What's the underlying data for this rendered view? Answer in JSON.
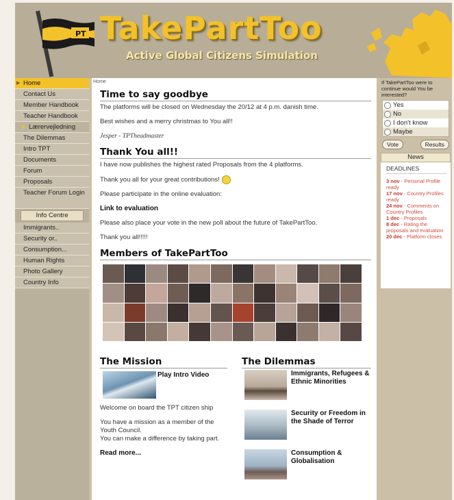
{
  "header": {
    "title": "TakePartToo",
    "subtitle": "Active Global Citizens Simulation",
    "flag_text": "PT"
  },
  "nav": {
    "items": [
      {
        "label": "Home"
      },
      {
        "label": "Contact Us"
      },
      {
        "label": "Member Handbook"
      },
      {
        "label": "Teacher Handbook"
      },
      {
        "label": "Lærervejledning"
      },
      {
        "label": "The Dilemmas"
      },
      {
        "label": "Intro TPT"
      },
      {
        "label": "Documents"
      },
      {
        "label": "Forum"
      },
      {
        "label": "Proposals"
      },
      {
        "label": "Teacher Forum Login"
      }
    ],
    "info_header": "Info Centre",
    "info_items": [
      {
        "label": "Immigrants.."
      },
      {
        "label": "Security or.."
      },
      {
        "label": "Consumption..."
      },
      {
        "label": "Human Rights"
      },
      {
        "label": "Photo Gallery"
      },
      {
        "label": "Country Info"
      }
    ]
  },
  "main": {
    "breadcrumb": "Home",
    "post1": {
      "title": "Time to say goodbye",
      "p1": "The platforms will be closed on Wednesday the 20/12 at 4 p.m. danish time.",
      "p2": "Best wishes and a merry christmas to You all!!",
      "signature": "Jesper - TPTheadmaster"
    },
    "post2": {
      "title": "Thank You all!!",
      "p1": "I have now publishes the highest rated Proposals from the 4 platforms.",
      "p2": "Thank you all for your great contributions!",
      "p3": "Please participate in the online evaluation:",
      "link": "Link to evaluation",
      "p4": "Please also place your vote in the new poll about the future of TakePartToo.",
      "p5": "Thank you all!!!!!"
    },
    "members_title": "Members of TakePartToo",
    "mission": {
      "title": "The Mission",
      "video_label": "Play Intro Video",
      "p1": "Welcome on board the TPT citizen ship",
      "p2": "You have a mission as a member of the Youth Council.",
      "p3": "You can make a difference by taking part.",
      "read_more": "Read more..."
    },
    "dilemmas": {
      "title": "The Dilemmas",
      "items": [
        {
          "label": "Immigrants, Refugees & Ethnic Minorities"
        },
        {
          "label": "Security or Freedom in the Shade of Terror"
        },
        {
          "label": "Consumption & Globalisation"
        }
      ]
    }
  },
  "poll": {
    "question": "If TakePartToo were to continue would You be interested?",
    "options": [
      "Yes",
      "No",
      "I don't know",
      "Maybe"
    ],
    "vote_label": "Vote",
    "results_label": "Results"
  },
  "news": {
    "header": "News",
    "deadlines_title": "DEADLINES",
    "items": [
      {
        "date": "3 nov",
        "text": " - Personal Profile ready"
      },
      {
        "date": "17 nov",
        "text": " - Country Profiles ready"
      },
      {
        "date": "24 nov",
        "text": " - Comments on Country Profiles"
      },
      {
        "date": "1 dec",
        "text": " - Proposals"
      },
      {
        "date": "8 dec",
        "text": " - Rating the proposals and evaluation"
      },
      {
        "date": "20 dec",
        "text": " - Platform closes"
      }
    ]
  },
  "colors": {
    "accent_yellow": "#f3c12a",
    "header_bg": "#b8ad97",
    "deadline_red": "#d14a3a"
  }
}
